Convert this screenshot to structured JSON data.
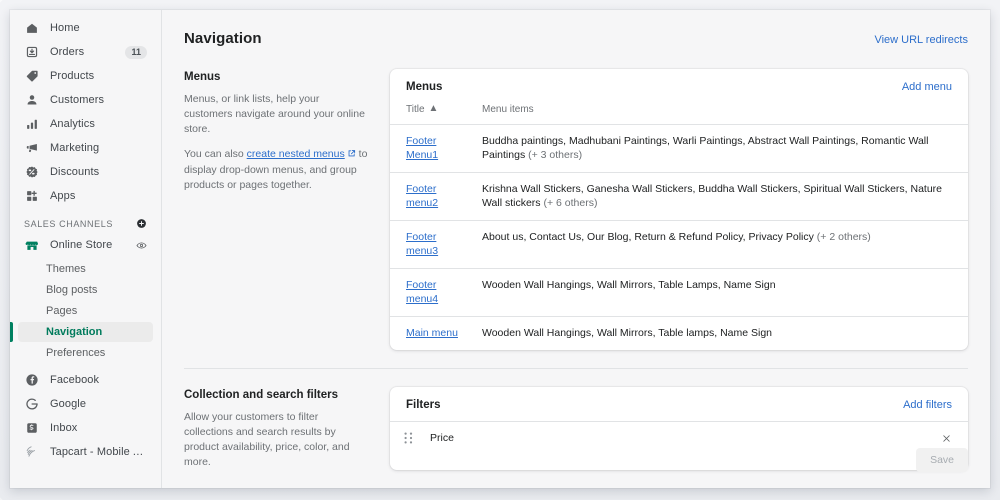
{
  "sidebar": {
    "primary_items": [
      {
        "label": "Home",
        "icon": "home-icon",
        "badge": ""
      },
      {
        "label": "Orders",
        "icon": "orders-icon",
        "badge": "11"
      },
      {
        "label": "Products",
        "icon": "products-tag-icon",
        "badge": ""
      },
      {
        "label": "Customers",
        "icon": "customers-person-icon",
        "badge": ""
      },
      {
        "label": "Analytics",
        "icon": "analytics-bars-icon",
        "badge": ""
      },
      {
        "label": "Marketing",
        "icon": "marketing-megaphone-icon",
        "badge": ""
      },
      {
        "label": "Discounts",
        "icon": "discounts-icon",
        "badge": ""
      },
      {
        "label": "Apps",
        "icon": "apps-grid-icon",
        "badge": ""
      }
    ],
    "sales_channels_label": "SALES CHANNELS",
    "sales_channels_add_icon": "plus-circle-icon",
    "online_store": {
      "label": "Online Store",
      "icon": "online-store-icon",
      "preview_icon": "eye-icon",
      "accent": "#008060"
    },
    "online_store_children": [
      {
        "label": "Themes",
        "active": false
      },
      {
        "label": "Blog posts",
        "active": false
      },
      {
        "label": "Pages",
        "active": false
      },
      {
        "label": "Navigation",
        "active": true
      },
      {
        "label": "Preferences",
        "active": false
      }
    ],
    "apps": [
      {
        "label": "Facebook",
        "icon": "facebook-icon"
      },
      {
        "label": "Google",
        "icon": "google-icon"
      },
      {
        "label": "Inbox",
        "icon": "inbox-icon"
      },
      {
        "label": "Tapcart - Mobile App",
        "icon": "tapcart-icon"
      }
    ]
  },
  "header": {
    "title": "Navigation",
    "url_redirects_link": "View URL redirects"
  },
  "menus_section": {
    "heading": "Menus",
    "paragraph_1": "Menus, or link lists, help your customers navigate around your online store.",
    "paragraph_2_before": "You can also ",
    "nested_link": "create nested menus",
    "paragraph_2_after": " to display drop-down menus, and group products or pages together.",
    "card_title": "Menus",
    "add_menu_link": "Add menu",
    "columns": {
      "title": "Title",
      "items": "Menu items"
    },
    "sort_caret": "▲",
    "rows": [
      {
        "title": "Footer Menu1",
        "items": "Buddha paintings, Madhubani Paintings, Warli Paintings, Abstract Wall Paintings, Romantic Wall Paintings",
        "more": "(+ 3 others)"
      },
      {
        "title": "Footer menu2",
        "items": "Krishna Wall Stickers, Ganesha Wall Stickers, Buddha Wall Stickers, Spiritual Wall Stickers, Nature Wall stickers",
        "more": "(+ 6 others)"
      },
      {
        "title": "Footer menu3",
        "items": "About us, Contact Us, Our Blog, Return & Refund Policy, Privacy Policy",
        "more": "(+ 2 others)"
      },
      {
        "title": "Footer menu4",
        "items": "Wooden Wall Hangings, Wall Mirrors, Table Lamps, Name Sign",
        "more": ""
      },
      {
        "title": "Main menu",
        "items": "Wooden Wall Hangings, Wall Mirrors, Table lamps, Name Sign",
        "more": ""
      }
    ]
  },
  "filters_section": {
    "heading": "Collection and search filters",
    "paragraph": "Allow your customers to filter collections and search results by product availability, price, color, and more.",
    "card_title": "Filters",
    "add_filters_link": "Add filters",
    "rows": [
      {
        "name": "Price",
        "drag_icon": "drag-handle-icon",
        "remove_icon": "close-icon"
      }
    ]
  },
  "footer": {
    "save_label": "Save",
    "save_disabled": true
  },
  "colors": {
    "accent_green": "#008060",
    "link_blue": "#2c6ecb",
    "page_bg": "#f6f6f7",
    "card_bg": "#ffffff",
    "border": "#e1e3e5",
    "text": "#202223",
    "muted_text": "#6d7175"
  }
}
